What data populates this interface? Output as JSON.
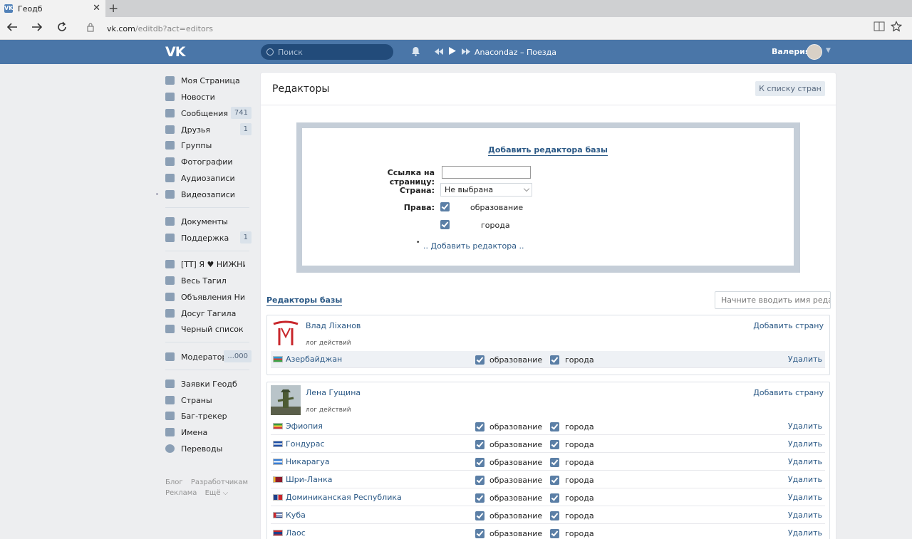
{
  "browser": {
    "tab_title": "Геодб",
    "tab_close": "✕",
    "new_tab": "+",
    "url_host": "vk.com",
    "url_path": "/editdb?act=editors",
    "vk_favicon": "VK"
  },
  "header": {
    "logo": "VK",
    "search_placeholder": "Поиск",
    "track": "Anacondaz – Поезда",
    "user_name": "Валерия"
  },
  "sidebar": {
    "items": [
      {
        "label": "Моя Страница",
        "icon": "home-icon"
      },
      {
        "label": "Новости",
        "icon": "news-icon"
      },
      {
        "label": "Сообщения",
        "icon": "messages-icon",
        "count": "741"
      },
      {
        "label": "Друзья",
        "icon": "friends-icon",
        "count": "1"
      },
      {
        "label": "Группы",
        "icon": "groups-icon"
      },
      {
        "label": "Фотографии",
        "icon": "photos-icon"
      },
      {
        "label": "Аудиозаписи",
        "icon": "audio-icon"
      },
      {
        "label": "Видеозаписи",
        "icon": "video-icon"
      },
      {
        "label": "Документы",
        "icon": "documents-icon"
      },
      {
        "label": "Поддержка",
        "icon": "support-icon",
        "count": "1"
      },
      {
        "label": "[TT] Я ♥ НИЖНИЙ...",
        "icon": "group-icon"
      },
      {
        "label": "Весь Тагил",
        "icon": "group-icon"
      },
      {
        "label": "Объявления Нижн...",
        "icon": "group-icon"
      },
      {
        "label": "Досуг Тагила",
        "icon": "group-icon"
      },
      {
        "label": "Черный список Т...",
        "icon": "group-icon"
      },
      {
        "label": "Модератор",
        "icon": "apps-icon",
        "count": "...000"
      },
      {
        "label": "Заявки Геодб",
        "icon": "briefcase-icon"
      },
      {
        "label": "Страны",
        "icon": "briefcase-icon"
      },
      {
        "label": "Баг-трекер",
        "icon": "briefcase-icon"
      },
      {
        "label": "Имена",
        "icon": "briefcase-icon"
      },
      {
        "label": "Переводы",
        "icon": "globe-icon"
      }
    ],
    "footer": {
      "blog": "Блог",
      "developers": "Разработчикам",
      "ads": "Реклама",
      "more": "Ещё ⌵"
    }
  },
  "main": {
    "title": "Редакторы",
    "back_button": "К списку стран",
    "form": {
      "title": "Добавить редактора базы",
      "link_label": "Ссылка на страницу:",
      "link_value": "",
      "country_label": "Страна:",
      "country_value": "Не выбрана",
      "rights_label": "Права:",
      "right_education": "образование",
      "right_cities": "города",
      "add_link": ".. Добавить редактора ..",
      "bullet": "•"
    },
    "editors_title": "Редакторы базы",
    "editors_search_placeholder": "Начните вводить имя реда...",
    "editors": [
      {
        "name": "Влад Ліханов",
        "log": "лог действий",
        "add_country": "Добавить страну",
        "countries": [
          {
            "name": "Азербайджан",
            "education": "образование",
            "cities": "города",
            "delete": "Удалить"
          }
        ]
      },
      {
        "name": "Лена Гущина",
        "log": "лог действий",
        "add_country": "Добавить страну",
        "countries": [
          {
            "name": "Эфиопия",
            "education": "образование",
            "cities": "города",
            "delete": "Удалить"
          },
          {
            "name": "Гондурас",
            "education": "образование",
            "cities": "города",
            "delete": "Удалить"
          },
          {
            "name": "Никарагуа",
            "education": "образование",
            "cities": "города",
            "delete": "Удалить"
          },
          {
            "name": "Шри-Ланка",
            "education": "образование",
            "cities": "города",
            "delete": "Удалить"
          },
          {
            "name": "Доминиканская Республика",
            "education": "образование",
            "cities": "города",
            "delete": "Удалить"
          },
          {
            "name": "Куба",
            "education": "образование",
            "cities": "города",
            "delete": "Удалить"
          },
          {
            "name": "Лаос",
            "education": "образование",
            "cities": "города",
            "delete": "Удалить"
          }
        ]
      }
    ]
  },
  "colors": {
    "vk_blue": "#4a76a8",
    "link": "#2a5885",
    "checkbox": "#5b7fa6",
    "page_bg": "#edeef0"
  }
}
